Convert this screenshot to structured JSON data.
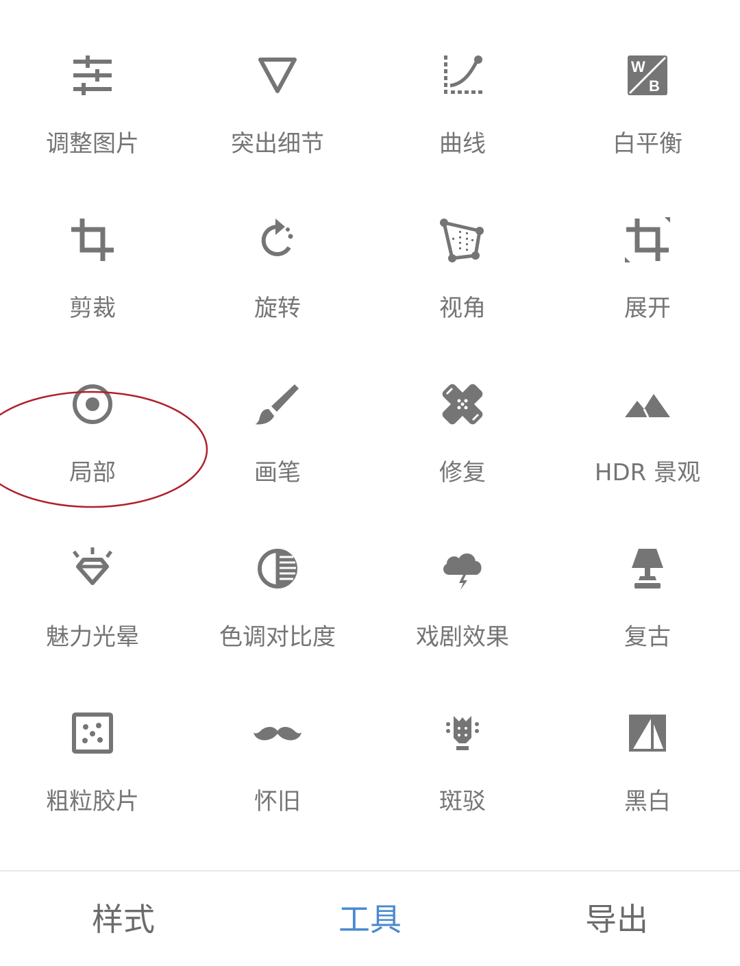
{
  "tools": [
    {
      "label": "调整图片",
      "icon": "sliders-icon"
    },
    {
      "label": "突出细节",
      "icon": "triangle-down-icon"
    },
    {
      "label": "曲线",
      "icon": "curve-icon"
    },
    {
      "label": "白平衡",
      "icon": "white-balance-icon"
    },
    {
      "label": "剪裁",
      "icon": "crop-icon"
    },
    {
      "label": "旋转",
      "icon": "rotate-icon"
    },
    {
      "label": "视角",
      "icon": "perspective-icon"
    },
    {
      "label": "展开",
      "icon": "expand-icon"
    },
    {
      "label": "局部",
      "icon": "target-icon"
    },
    {
      "label": "画笔",
      "icon": "brush-icon"
    },
    {
      "label": "修复",
      "icon": "bandage-icon"
    },
    {
      "label": "HDR 景观",
      "icon": "mountain-icon"
    },
    {
      "label": "魅力光晕",
      "icon": "diamond-glow-icon"
    },
    {
      "label": "色调对比度",
      "icon": "tonal-contrast-icon"
    },
    {
      "label": "戏剧效果",
      "icon": "storm-cloud-icon"
    },
    {
      "label": "复古",
      "icon": "lamp-icon"
    },
    {
      "label": "粗粒胶片",
      "icon": "film-grain-icon"
    },
    {
      "label": "怀旧",
      "icon": "mustache-icon"
    },
    {
      "label": "斑驳",
      "icon": "grunge-guitar-icon"
    },
    {
      "label": "黑白",
      "icon": "black-white-icon"
    }
  ],
  "tabs": [
    {
      "label": "样式",
      "active": false
    },
    {
      "label": "工具",
      "active": true
    },
    {
      "label": "导出",
      "active": false
    }
  ],
  "colors": {
    "icon": "#757575",
    "label": "#757575",
    "active_tab": "#4a8ad0",
    "highlight_ring": "#b0202a"
  }
}
